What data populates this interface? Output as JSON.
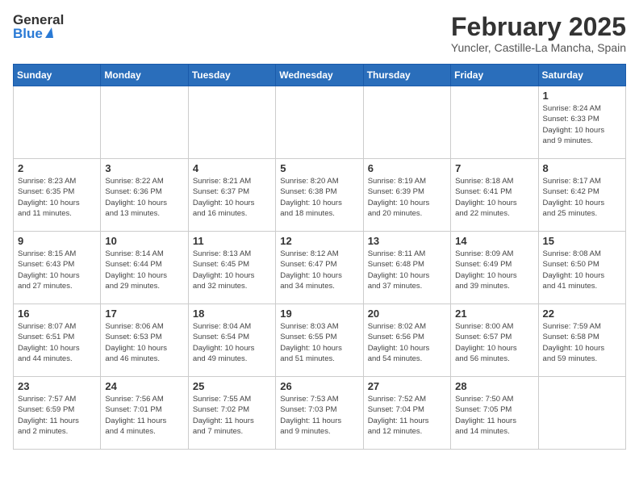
{
  "header": {
    "logo_general": "General",
    "logo_blue": "Blue",
    "month": "February 2025",
    "location": "Yuncler, Castille-La Mancha, Spain"
  },
  "weekdays": [
    "Sunday",
    "Monday",
    "Tuesday",
    "Wednesday",
    "Thursday",
    "Friday",
    "Saturday"
  ],
  "weeks": [
    [
      {
        "day": "",
        "info": ""
      },
      {
        "day": "",
        "info": ""
      },
      {
        "day": "",
        "info": ""
      },
      {
        "day": "",
        "info": ""
      },
      {
        "day": "",
        "info": ""
      },
      {
        "day": "",
        "info": ""
      },
      {
        "day": "1",
        "info": "Sunrise: 8:24 AM\nSunset: 6:33 PM\nDaylight: 10 hours\nand 9 minutes."
      }
    ],
    [
      {
        "day": "2",
        "info": "Sunrise: 8:23 AM\nSunset: 6:35 PM\nDaylight: 10 hours\nand 11 minutes."
      },
      {
        "day": "3",
        "info": "Sunrise: 8:22 AM\nSunset: 6:36 PM\nDaylight: 10 hours\nand 13 minutes."
      },
      {
        "day": "4",
        "info": "Sunrise: 8:21 AM\nSunset: 6:37 PM\nDaylight: 10 hours\nand 16 minutes."
      },
      {
        "day": "5",
        "info": "Sunrise: 8:20 AM\nSunset: 6:38 PM\nDaylight: 10 hours\nand 18 minutes."
      },
      {
        "day": "6",
        "info": "Sunrise: 8:19 AM\nSunset: 6:39 PM\nDaylight: 10 hours\nand 20 minutes."
      },
      {
        "day": "7",
        "info": "Sunrise: 8:18 AM\nSunset: 6:41 PM\nDaylight: 10 hours\nand 22 minutes."
      },
      {
        "day": "8",
        "info": "Sunrise: 8:17 AM\nSunset: 6:42 PM\nDaylight: 10 hours\nand 25 minutes."
      }
    ],
    [
      {
        "day": "9",
        "info": "Sunrise: 8:15 AM\nSunset: 6:43 PM\nDaylight: 10 hours\nand 27 minutes."
      },
      {
        "day": "10",
        "info": "Sunrise: 8:14 AM\nSunset: 6:44 PM\nDaylight: 10 hours\nand 29 minutes."
      },
      {
        "day": "11",
        "info": "Sunrise: 8:13 AM\nSunset: 6:45 PM\nDaylight: 10 hours\nand 32 minutes."
      },
      {
        "day": "12",
        "info": "Sunrise: 8:12 AM\nSunset: 6:47 PM\nDaylight: 10 hours\nand 34 minutes."
      },
      {
        "day": "13",
        "info": "Sunrise: 8:11 AM\nSunset: 6:48 PM\nDaylight: 10 hours\nand 37 minutes."
      },
      {
        "day": "14",
        "info": "Sunrise: 8:09 AM\nSunset: 6:49 PM\nDaylight: 10 hours\nand 39 minutes."
      },
      {
        "day": "15",
        "info": "Sunrise: 8:08 AM\nSunset: 6:50 PM\nDaylight: 10 hours\nand 41 minutes."
      }
    ],
    [
      {
        "day": "16",
        "info": "Sunrise: 8:07 AM\nSunset: 6:51 PM\nDaylight: 10 hours\nand 44 minutes."
      },
      {
        "day": "17",
        "info": "Sunrise: 8:06 AM\nSunset: 6:53 PM\nDaylight: 10 hours\nand 46 minutes."
      },
      {
        "day": "18",
        "info": "Sunrise: 8:04 AM\nSunset: 6:54 PM\nDaylight: 10 hours\nand 49 minutes."
      },
      {
        "day": "19",
        "info": "Sunrise: 8:03 AM\nSunset: 6:55 PM\nDaylight: 10 hours\nand 51 minutes."
      },
      {
        "day": "20",
        "info": "Sunrise: 8:02 AM\nSunset: 6:56 PM\nDaylight: 10 hours\nand 54 minutes."
      },
      {
        "day": "21",
        "info": "Sunrise: 8:00 AM\nSunset: 6:57 PM\nDaylight: 10 hours\nand 56 minutes."
      },
      {
        "day": "22",
        "info": "Sunrise: 7:59 AM\nSunset: 6:58 PM\nDaylight: 10 hours\nand 59 minutes."
      }
    ],
    [
      {
        "day": "23",
        "info": "Sunrise: 7:57 AM\nSunset: 6:59 PM\nDaylight: 11 hours\nand 2 minutes."
      },
      {
        "day": "24",
        "info": "Sunrise: 7:56 AM\nSunset: 7:01 PM\nDaylight: 11 hours\nand 4 minutes."
      },
      {
        "day": "25",
        "info": "Sunrise: 7:55 AM\nSunset: 7:02 PM\nDaylight: 11 hours\nand 7 minutes."
      },
      {
        "day": "26",
        "info": "Sunrise: 7:53 AM\nSunset: 7:03 PM\nDaylight: 11 hours\nand 9 minutes."
      },
      {
        "day": "27",
        "info": "Sunrise: 7:52 AM\nSunset: 7:04 PM\nDaylight: 11 hours\nand 12 minutes."
      },
      {
        "day": "28",
        "info": "Sunrise: 7:50 AM\nSunset: 7:05 PM\nDaylight: 11 hours\nand 14 minutes."
      },
      {
        "day": "",
        "info": ""
      }
    ]
  ]
}
